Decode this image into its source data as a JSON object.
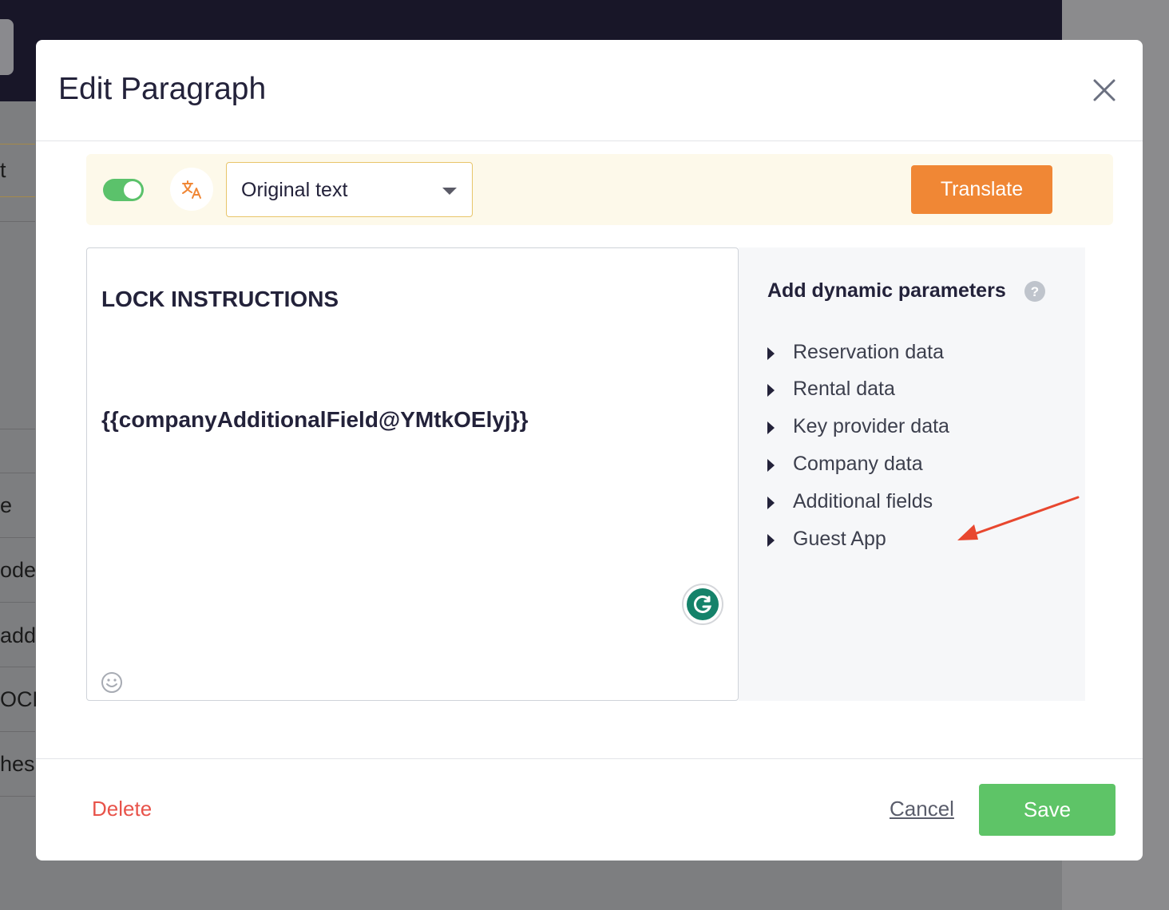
{
  "background": {
    "fragments": [
      "t",
      "e",
      "ode",
      "addr",
      "OCK",
      " hes"
    ]
  },
  "modal": {
    "title": "Edit Paragraph",
    "close_icon": "close-icon"
  },
  "translate_bar": {
    "toggle_on": true,
    "translate_icon": "translate-icon",
    "language_selected": "Original text",
    "translate_label": "Translate"
  },
  "editor": {
    "heading": "LOCK INSTRUCTIONS",
    "token": "{{companyAdditionalField@YMtkOElyj}}",
    "grammarly_icon": "grammarly-icon",
    "emoji_icon": "emoji-icon"
  },
  "params": {
    "title": "Add dynamic parameters",
    "help_icon": "help-icon",
    "items": [
      {
        "label": "Reservation data"
      },
      {
        "label": "Rental data"
      },
      {
        "label": "Key provider data"
      },
      {
        "label": "Company data"
      },
      {
        "label": "Additional fields"
      },
      {
        "label": "Guest App"
      }
    ]
  },
  "footer": {
    "delete_label": "Delete",
    "cancel_label": "Cancel",
    "save_label": "Save"
  },
  "colors": {
    "overlay": "#7d7e80",
    "toggle_on": "#5bc26b",
    "translate_button": "#f08735",
    "save_button": "#5ec467",
    "delete_text": "#e8534a",
    "annotation_arrow": "#e8472f"
  }
}
